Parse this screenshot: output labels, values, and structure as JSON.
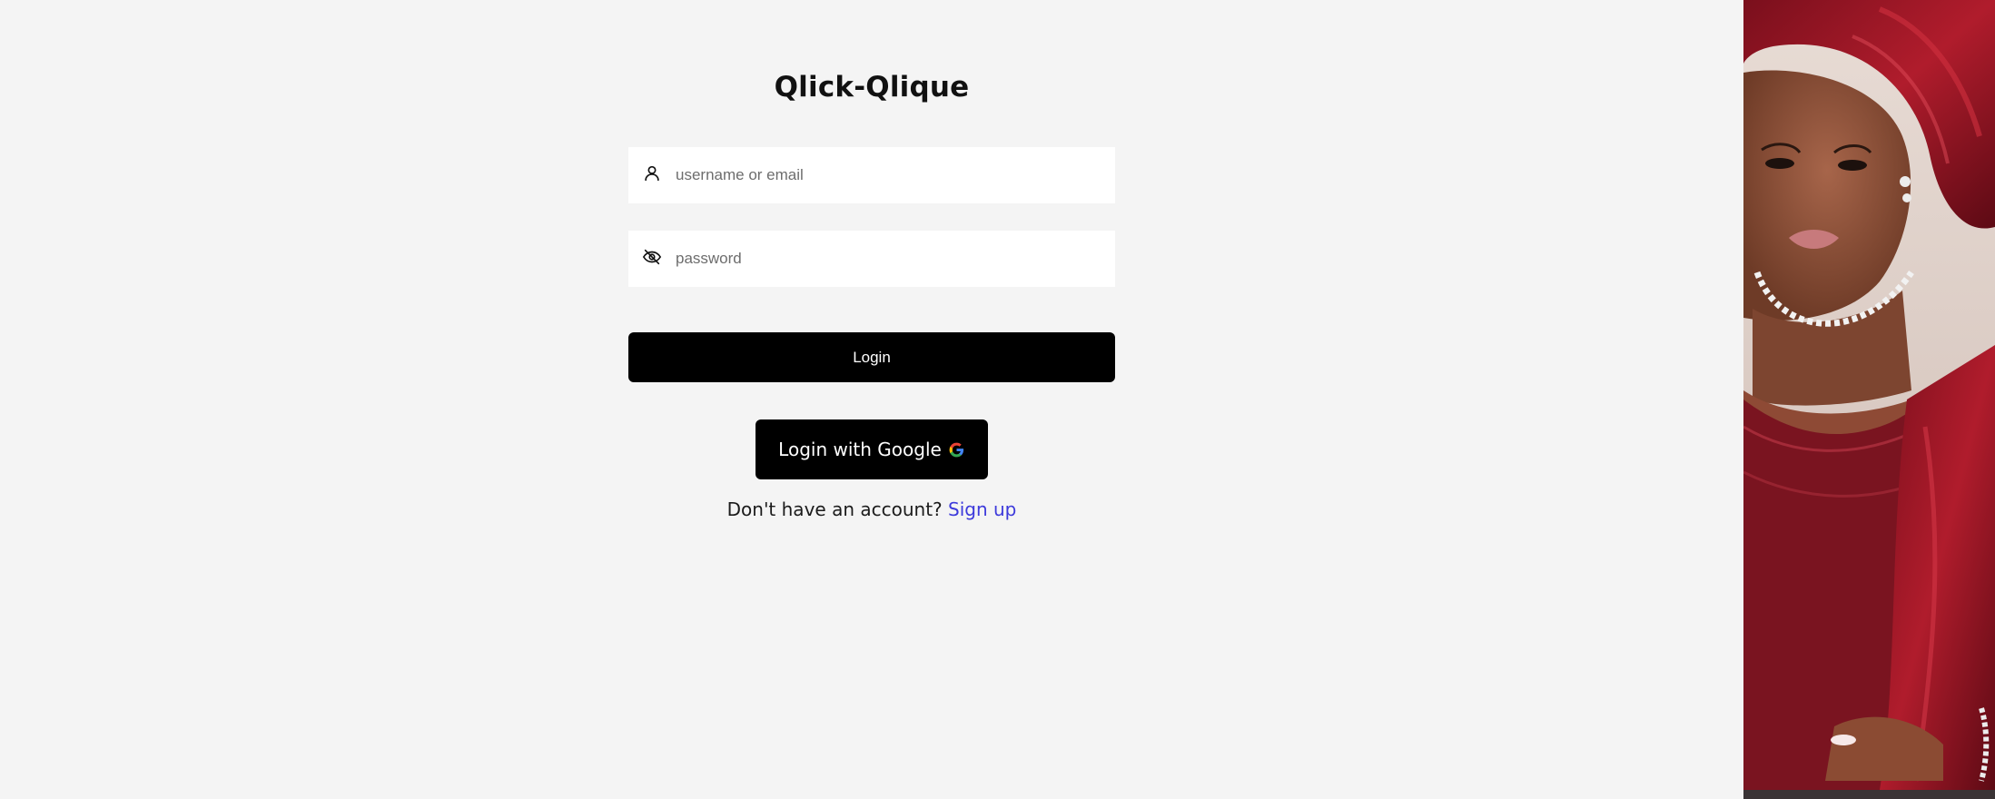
{
  "app": {
    "title": "Qlick-Qlique"
  },
  "form": {
    "username": {
      "placeholder": "username or email",
      "icon": "user-icon"
    },
    "password": {
      "placeholder": "password",
      "icon": "eye-slash-icon"
    },
    "login_label": "Login",
    "google_label": "Login with Google",
    "google_icon": "google-g-icon"
  },
  "signup": {
    "prompt": "Don't have an account?",
    "link_label": "Sign up"
  },
  "colors": {
    "background": "#f4f4f4",
    "button": "#000000",
    "link": "#3d3adb"
  },
  "side_image": {
    "icon": "portrait-photo"
  }
}
